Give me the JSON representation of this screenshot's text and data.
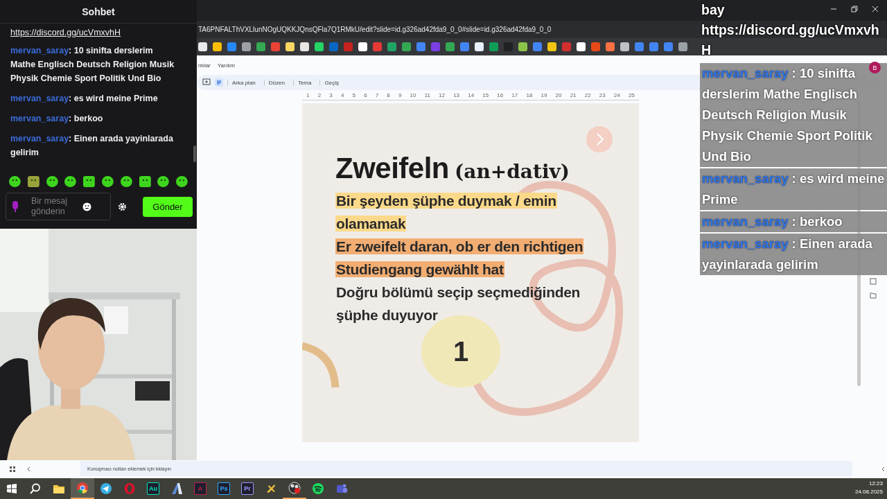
{
  "chat": {
    "title": "Sohbet",
    "messages": [
      {
        "kind": "link",
        "text": "https://discord.gg/ucVmxvhH"
      },
      {
        "kind": "message",
        "user": "mervan_saray",
        "text": ": 10 sinifta derslerim Mathe Englisch Deutsch Religion Musik Physik Chemie Sport Politik Und Bio"
      },
      {
        "kind": "message",
        "user": "mervan_saray",
        "text": ": es wird meine Prime"
      },
      {
        "kind": "message",
        "user": "mervan_saray",
        "text": ": berkoo"
      },
      {
        "kind": "message",
        "user": "mervan_saray",
        "text": ": Einen arada yayinlarada gelirim"
      }
    ],
    "input": {
      "placeholder": "Bir mesaj gönderin"
    },
    "send_button": "Gönder"
  },
  "browser": {
    "url": "TA6PNFALThVXLlunNOgUQKKJQnsQFla7Q1RMkU/edit?slide=id.g326ad42fda9_0_0#slide=id.g326ad42fda9_0_0",
    "menu": [
      "ntılar",
      "Yardım"
    ],
    "toolbar": [
      "Arka plan",
      "Düzen",
      "Tema",
      "Geçiş"
    ],
    "ruler": [
      "1",
      "2",
      "3",
      "4",
      "5",
      "6",
      "7",
      "8",
      "9",
      "10",
      "11",
      "12",
      "13",
      "14",
      "15",
      "16",
      "17",
      "18",
      "19",
      "20",
      "21",
      "22",
      "23",
      "24",
      "25"
    ],
    "profile_initial": "B",
    "notes_placeholder": "Konuşmacı notları eklemek için tıklayın"
  },
  "slide": {
    "title": "Zweifeln",
    "subtitle": "(an+dativ)",
    "lines": [
      {
        "text": "Bir şeyden şüphe duymak / emin",
        "color": "#fbd98a"
      },
      {
        "text": "olamamak",
        "color": "#fbd98a"
      },
      {
        "text": "Er zweifelt daran, ob er den richtigen",
        "color": "#f2ad72"
      },
      {
        "text": "Studiengang gewählt hat",
        "color": "#f2ad72"
      },
      {
        "text": "Doğru bölümü seçip seçmediğinden"
      },
      {
        "text": "şüphe duyuyor"
      }
    ],
    "number": "1"
  },
  "overlay": {
    "lines": [
      "bay",
      "https://discord.gg/ucVmxvh",
      "H"
    ],
    "messages": [
      {
        "user": "mervan_saray",
        "text": " : 10 sinifta derslerim Mathe Englisch Deutsch Religion Musik Physik Chemie Sport Politik Und Bio"
      },
      {
        "user": "mervan_saray",
        "text": " : es wird meine Prime"
      },
      {
        "user": "mervan_saray",
        "text": " : berkoo"
      },
      {
        "user": "mervan_saray",
        "text": " : Einen arada yayinlarada gelirim"
      }
    ]
  },
  "taskbar": {
    "apps": [
      {
        "kind": "folder",
        "selected": false,
        "open": false
      },
      {
        "kind": "chrome",
        "selected": true,
        "open": true
      },
      {
        "kind": "telegram",
        "selected": false,
        "open": false
      },
      {
        "kind": "opera",
        "selected": false,
        "open": false
      },
      {
        "kind": "badge",
        "label": "Au",
        "color": "#00e4bb",
        "selected": false,
        "open": false
      },
      {
        "kind": "autodesk",
        "selected": false,
        "open": false
      },
      {
        "kind": "badge",
        "label": "A",
        "color": "#c21f4a",
        "selected": false,
        "open": false
      },
      {
        "kind": "badge",
        "label": "Ps",
        "color": "#31a8ff",
        "selected": false,
        "open": false
      },
      {
        "kind": "badge",
        "label": "Pr",
        "color": "#9999ff",
        "selected": false,
        "open": false
      },
      {
        "kind": "tool",
        "selected": false,
        "open": false
      },
      {
        "kind": "obs",
        "selected": false,
        "open": true
      },
      {
        "kind": "spotify",
        "selected": false,
        "open": false
      },
      {
        "kind": "teams",
        "selected": false,
        "open": false
      }
    ],
    "time": "12:23",
    "date": "24.08.2025"
  }
}
